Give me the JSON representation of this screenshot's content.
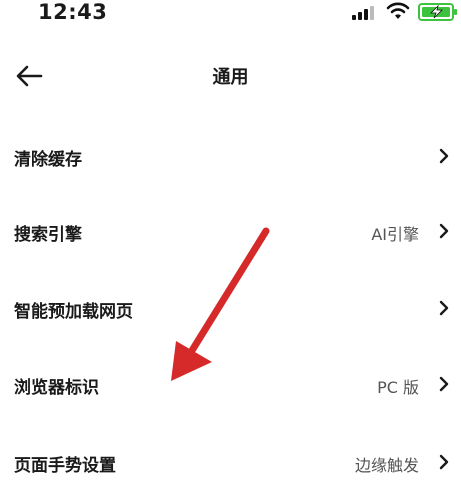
{
  "status_bar": {
    "time": "12:43"
  },
  "header": {
    "title": "通用"
  },
  "settings": [
    {
      "label": "清除缓存",
      "value": ""
    },
    {
      "label": "搜索引擎",
      "value": "AI引擎"
    },
    {
      "label": "智能预加载网页",
      "value": ""
    },
    {
      "label": "浏览器标识",
      "value": "PC 版"
    },
    {
      "label": "页面手势设置",
      "value": "边缘触发"
    }
  ],
  "colors": {
    "annotation": "#d62a2a",
    "battery": "#3ec33e",
    "text": "#1a1a1a",
    "secondary_text": "#555555"
  },
  "icons": [
    "signal-icon",
    "wifi-icon",
    "battery-charging-icon",
    "back-arrow-icon",
    "chevron-right-icon"
  ]
}
